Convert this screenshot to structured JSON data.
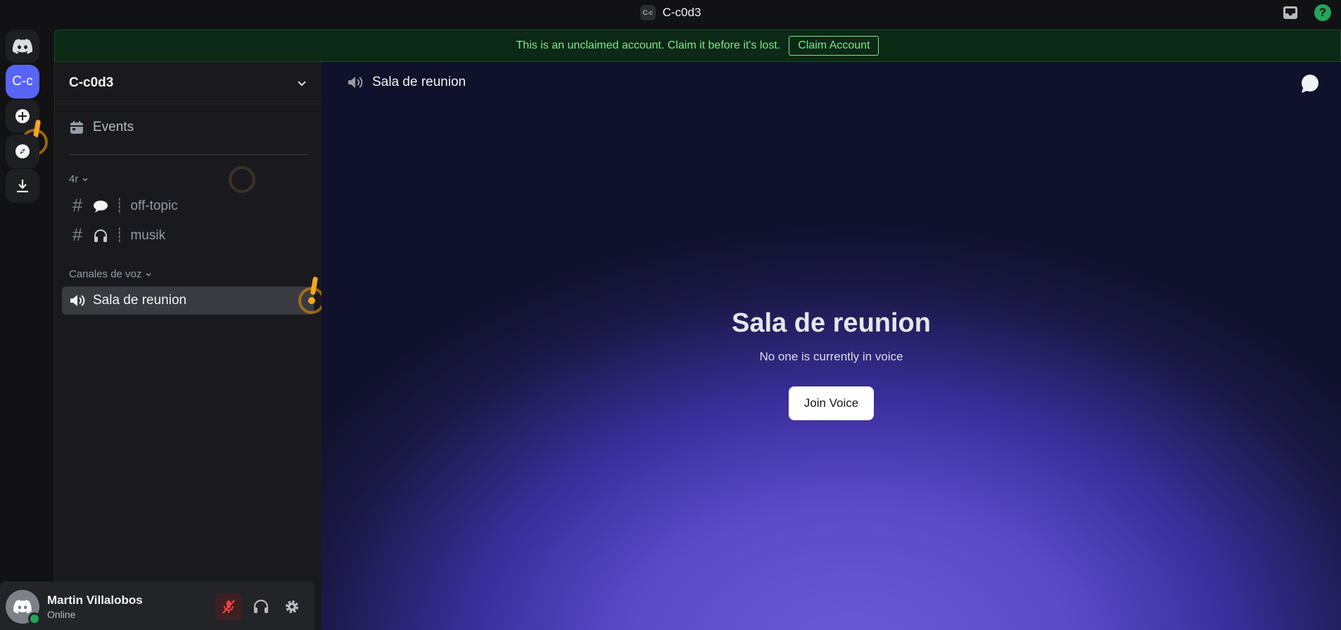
{
  "titlebar": {
    "badge": "C-c",
    "title": "C-c0d3"
  },
  "rail": {
    "server_abbrev": "C-c"
  },
  "banner": {
    "text": "This is an unclaimed account. Claim it before it's lost.",
    "button_label": "Claim Account"
  },
  "sidebar": {
    "guild_name": "C-c0d3",
    "events_label": "Events",
    "categories": [
      {
        "name": "4r",
        "channels": [
          {
            "emoji_icon": "speech-bubble-icon",
            "name": "off-topic",
            "separator": "┊"
          },
          {
            "emoji_icon": "headphones-icon",
            "name": "musik",
            "separator": "┊"
          }
        ]
      },
      {
        "name": "Canales de voz",
        "channels": [
          {
            "name": "Sala de reunion",
            "active": true
          }
        ]
      }
    ]
  },
  "user_panel": {
    "name": "Martin Villalobos",
    "status": "Online"
  },
  "main": {
    "header_title": "Sala de reunion",
    "voice_title": "Sala de reunion",
    "voice_subtitle": "No one is currently in voice",
    "join_label": "Join Voice"
  },
  "colors": {
    "accent": "#5865f2",
    "online": "#23a55a",
    "banner_text": "#7fe58f",
    "alert": "#f5a623"
  }
}
